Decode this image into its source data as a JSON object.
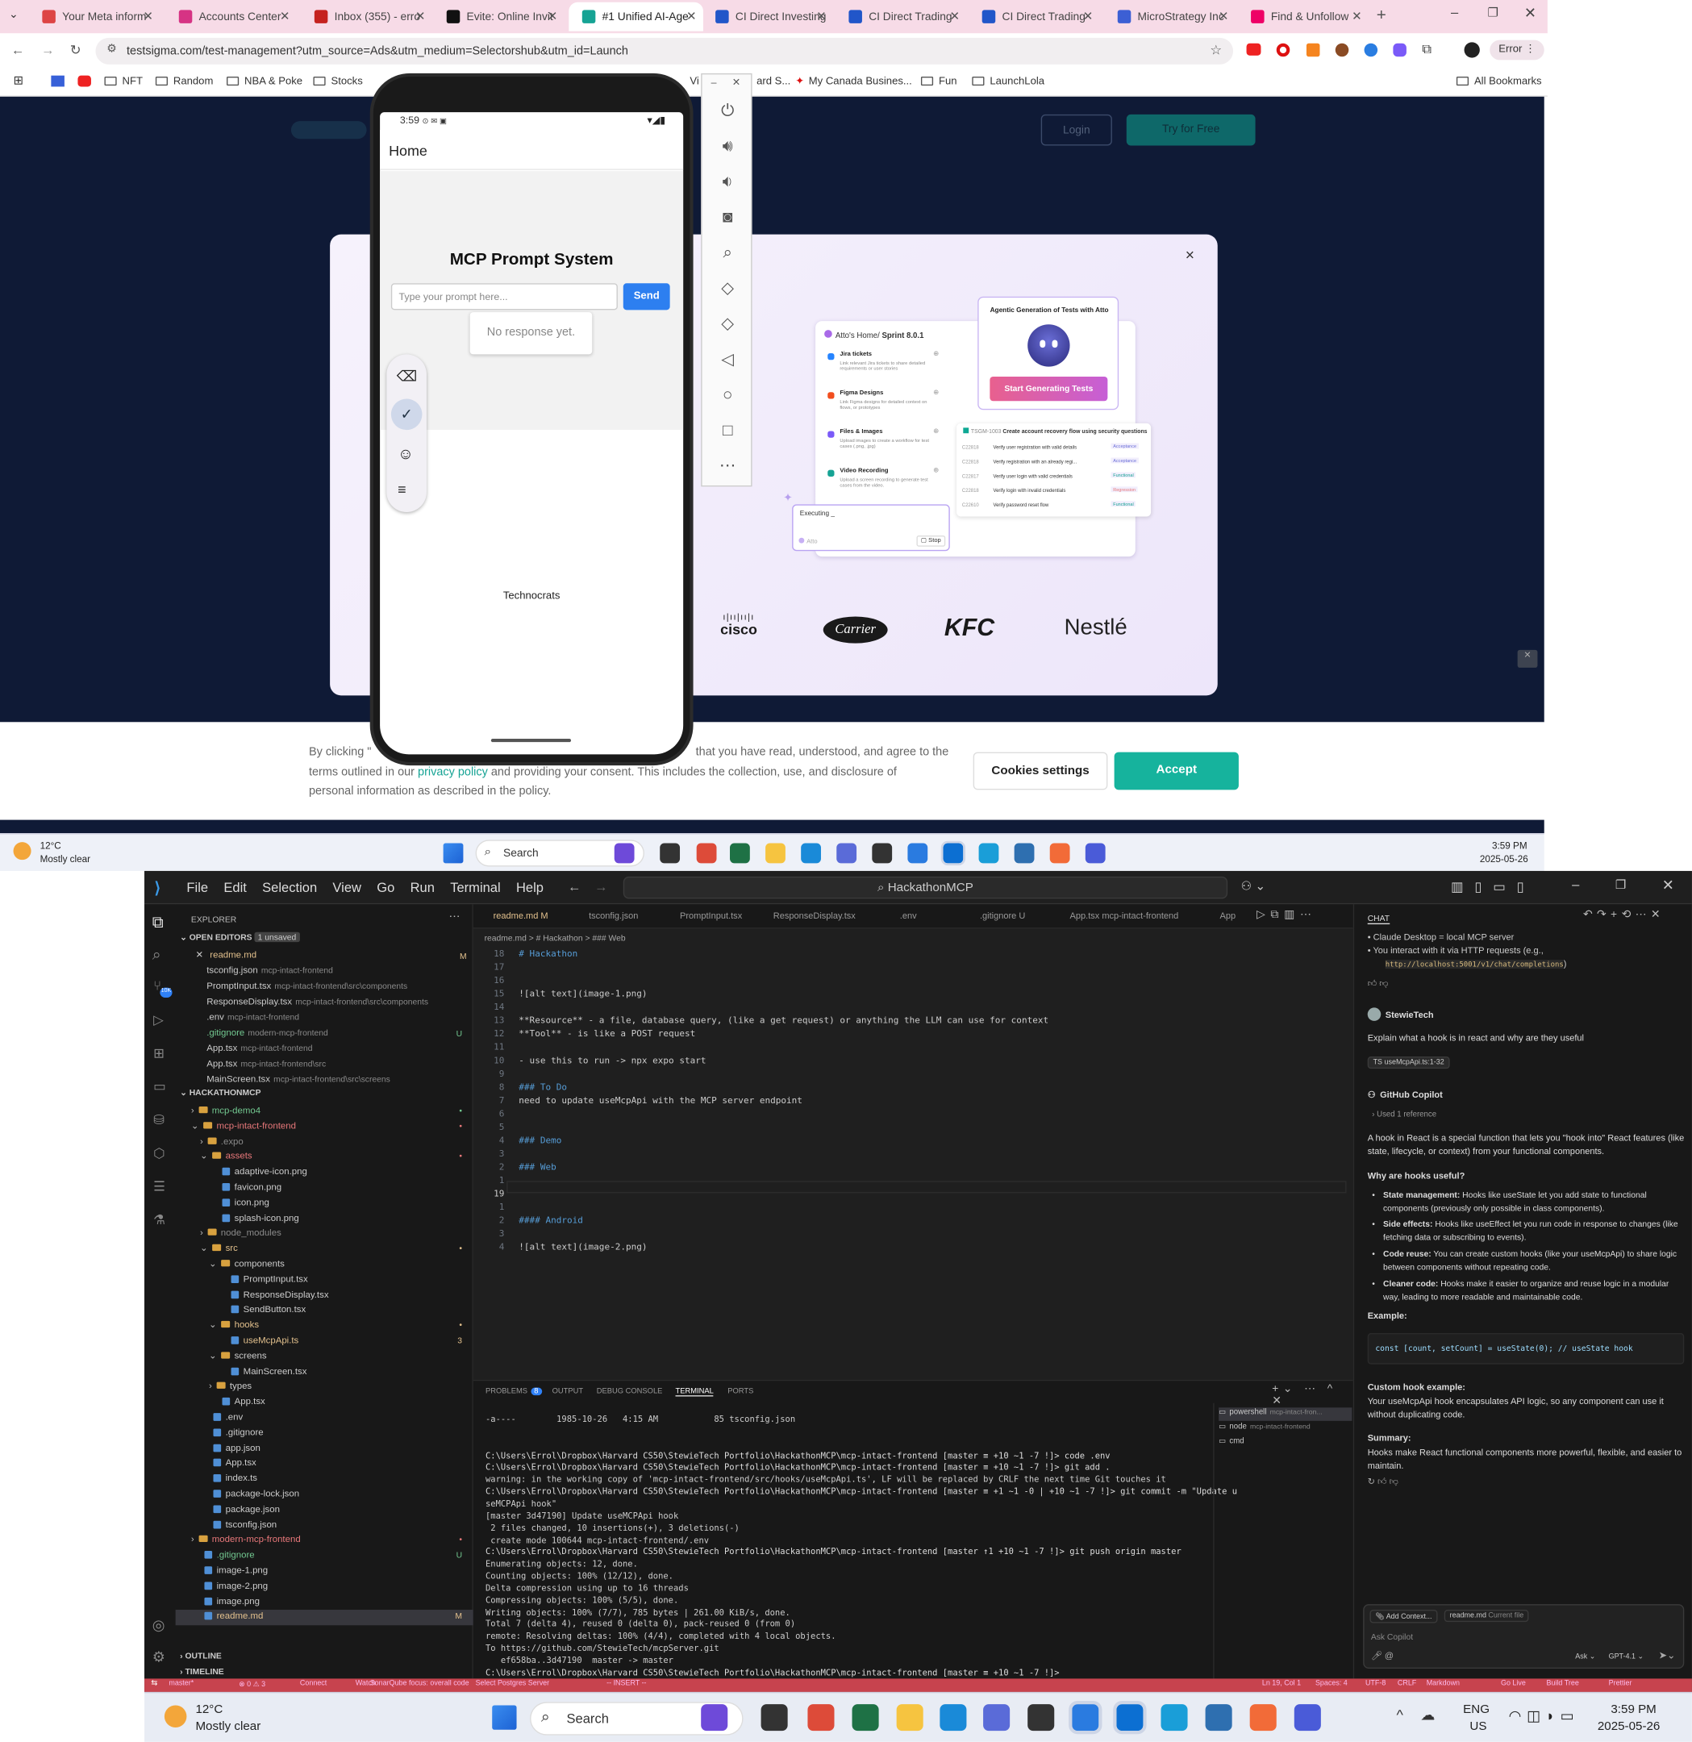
{
  "browser": {
    "tabs": [
      {
        "label": "Your Meta inform",
        "color": "#d44"
      },
      {
        "label": "Accounts Center",
        "color": "#d63384"
      },
      {
        "label": "Inbox (355) - erro",
        "color": "#c5221f"
      },
      {
        "label": "Evite: Online Invit",
        "color": "#111"
      },
      {
        "label": "#1 Unified AI-Age",
        "color": "#16a394"
      },
      {
        "label": "CI Direct Investing",
        "color": "#2156c9"
      },
      {
        "label": "CI Direct Trading",
        "color": "#2156c9"
      },
      {
        "label": "CI Direct Trading",
        "color": "#2156c9"
      },
      {
        "label": "MicroStrategy Inc",
        "color": "#3c5fd4"
      },
      {
        "label": "Find & Unfollow",
        "color": "#e06"
      }
    ],
    "url": "testsigma.com/test-management?utm_source=Ads&utm_medium=Selectorshub&utm_id=Launch",
    "error_label": "Error",
    "bookmarks": [
      "NFT",
      "Random",
      "NBA & Poke",
      "Stocks",
      "My Canada Busines...",
      "Fun",
      "LaunchLola",
      "All Bookmarks"
    ],
    "bookmark_fragment": "Vi",
    "bookmark_fragment2": "ard S..."
  },
  "webpage": {
    "modal": {
      "atto_home": "Atto's Home/",
      "sprint": "Sprint 8.0.1",
      "agentic_title": "Agentic Generation of Tests with Atto",
      "start_button": "Start Generating Tests",
      "items": [
        {
          "title": "Jira tickets",
          "desc": "Link relevant Jira tickets to share detailed requirements or user stories"
        },
        {
          "title": "Figma Designs",
          "desc": "Link Figma designs for detailed context on flows, or prototypes"
        },
        {
          "title": "Files & Images",
          "desc": "Upload images to create a workflow for test cases (.png, .jpg)"
        },
        {
          "title": "Video Recording",
          "desc": "Upload a screen recording to generate test cases from the video."
        }
      ],
      "test_header_id": "TSGM-1003",
      "test_header": "Create account recovery flow using security questions",
      "tests": [
        {
          "id": "C22818",
          "name": "Verify user registration with valid details",
          "tag": "Acceptance"
        },
        {
          "id": "C22818",
          "name": "Verify registration with an already regi...",
          "tag": "Acceptance"
        },
        {
          "id": "C22817",
          "name": "Verify user login with valid credentials",
          "tag": "Functional"
        },
        {
          "id": "C22818",
          "name": "Verify login with invalid credentials",
          "tag": "Regression"
        },
        {
          "id": "C22610",
          "name": "Verify password reset flow",
          "tag": "Functional"
        }
      ],
      "executing": "Executing _",
      "atto_label": "Atto",
      "stop_label": "Stop",
      "logos": [
        "cisco",
        "Carrier",
        "KFC",
        "Nestlé"
      ],
      "close": "×"
    },
    "nav": {
      "login": "Login",
      "try": "Try for Free"
    },
    "cookie": {
      "text1": "By clicking \"",
      "text1b": "that you have read, understood, and agree to the",
      "text2": "terms outlined in our",
      "link": "privacy policy",
      "text2b": "and providing your consent. This includes the collection, use, and disclosure of",
      "text3": "personal information as described in the policy.",
      "settings": "Cookies settings",
      "accept": "Accept"
    }
  },
  "phone": {
    "time": "3:59",
    "header": "Home",
    "title": "MCP Prompt System",
    "input_placeholder": "Type your prompt here...",
    "send": "Send",
    "response": "No response yet.",
    "footer": "Technocrats"
  },
  "emulator_icons": [
    "power-icon",
    "volume-up-icon",
    "volume-down-icon",
    "camera-icon",
    "zoom-icon",
    "rotate-left-icon",
    "rotate-right-icon",
    "back-icon",
    "home-icon",
    "overview-icon",
    "more-icon"
  ],
  "taskbar_top": {
    "weather_temp": "12°C",
    "weather_desc": "Mostly clear",
    "search": "Search",
    "time": "3:59 PM",
    "date": "2025-05-26"
  },
  "vscode": {
    "menu": [
      "File",
      "Edit",
      "Selection",
      "View",
      "Go",
      "Run",
      "Terminal",
      "Help"
    ],
    "command_center": "HackathonMCP",
    "explorer_title": "EXPLORER",
    "open_editors": "OPEN EDITORS",
    "unsaved": "1 unsaved",
    "open_files": [
      {
        "name": "readme.md",
        "path": "",
        "badge": "M",
        "color": "#e2c08d"
      },
      {
        "name": "tsconfig.json",
        "path": "mcp-intact-frontend",
        "badge": "",
        "color": "#ccc"
      },
      {
        "name": "PromptInput.tsx",
        "path": "mcp-intact-frontend\\src\\components",
        "badge": "",
        "color": "#ccc"
      },
      {
        "name": "ResponseDisplay.tsx",
        "path": "mcp-intact-frontend\\src\\components",
        "badge": "",
        "color": "#ccc"
      },
      {
        "name": ".env",
        "path": "mcp-intact-frontend",
        "badge": "",
        "color": "#ccc"
      },
      {
        "name": ".gitignore",
        "path": "modern-mcp-frontend",
        "badge": "U",
        "color": "#73c991"
      },
      {
        "name": "App.tsx",
        "path": "mcp-intact-frontend",
        "badge": "",
        "color": "#ccc"
      },
      {
        "name": "App.tsx",
        "path": "mcp-intact-frontend\\src",
        "badge": "",
        "color": "#ccc"
      },
      {
        "name": "MainScreen.tsx",
        "path": "mcp-intact-frontend\\src\\screens",
        "badge": "",
        "color": "#ccc"
      }
    ],
    "workspace": "HACKATHONMCP",
    "tree": [
      {
        "name": "mcp-demo4",
        "depth": 1,
        "color": "#73c991",
        "badge": "•",
        "folder": true
      },
      {
        "name": "mcp-intact-frontend",
        "depth": 1,
        "color": "#e8787a",
        "badge": "•",
        "folder": true,
        "open": true
      },
      {
        "name": ".expo",
        "depth": 2,
        "color": "#8b8b8b",
        "badge": "",
        "folder": true
      },
      {
        "name": "assets",
        "depth": 2,
        "color": "#e8787a",
        "badge": "•",
        "folder": true,
        "open": true
      },
      {
        "name": "adaptive-icon.png",
        "depth": 3,
        "color": "#ccc",
        "badge": ""
      },
      {
        "name": "favicon.png",
        "depth": 3,
        "color": "#ccc",
        "badge": ""
      },
      {
        "name": "icon.png",
        "depth": 3,
        "color": "#ccc",
        "badge": ""
      },
      {
        "name": "splash-icon.png",
        "depth": 3,
        "color": "#ccc",
        "badge": ""
      },
      {
        "name": "node_modules",
        "depth": 2,
        "color": "#8b8b8b",
        "badge": "",
        "folder": true
      },
      {
        "name": "src",
        "depth": 2,
        "color": "#e2c08d",
        "badge": "•",
        "folder": true,
        "open": true
      },
      {
        "name": "components",
        "depth": 3,
        "color": "#ccc",
        "badge": "",
        "folder": true,
        "open": true
      },
      {
        "name": "PromptInput.tsx",
        "depth": 4,
        "color": "#ccc",
        "badge": ""
      },
      {
        "name": "ResponseDisplay.tsx",
        "depth": 4,
        "color": "#ccc",
        "badge": ""
      },
      {
        "name": "SendButton.tsx",
        "depth": 4,
        "color": "#ccc",
        "badge": ""
      },
      {
        "name": "hooks",
        "depth": 3,
        "color": "#e2c08d",
        "badge": "•",
        "folder": true,
        "open": true
      },
      {
        "name": "useMcpApi.ts",
        "depth": 4,
        "color": "#e2c08d",
        "badge": "3"
      },
      {
        "name": "screens",
        "depth": 3,
        "color": "#ccc",
        "badge": "",
        "folder": true,
        "open": true
      },
      {
        "name": "MainScreen.tsx",
        "depth": 4,
        "color": "#ccc",
        "badge": ""
      },
      {
        "name": "types",
        "depth": 3,
        "color": "#ccc",
        "badge": "",
        "folder": true
      },
      {
        "name": "App.tsx",
        "depth": 3,
        "color": "#ccc",
        "badge": ""
      },
      {
        "name": ".env",
        "depth": 2,
        "color": "#ccc",
        "badge": ""
      },
      {
        "name": ".gitignore",
        "depth": 2,
        "color": "#ccc",
        "badge": ""
      },
      {
        "name": "app.json",
        "depth": 2,
        "color": "#ccc",
        "badge": ""
      },
      {
        "name": "App.tsx",
        "depth": 2,
        "color": "#ccc",
        "badge": ""
      },
      {
        "name": "index.ts",
        "depth": 2,
        "color": "#ccc",
        "badge": ""
      },
      {
        "name": "package-lock.json",
        "depth": 2,
        "color": "#ccc",
        "badge": ""
      },
      {
        "name": "package.json",
        "depth": 2,
        "color": "#ccc",
        "badge": ""
      },
      {
        "name": "tsconfig.json",
        "depth": 2,
        "color": "#ccc",
        "badge": ""
      },
      {
        "name": "modern-mcp-frontend",
        "depth": 1,
        "color": "#e8787a",
        "badge": "•",
        "folder": true
      },
      {
        "name": ".gitignore",
        "depth": 1,
        "color": "#73c991",
        "badge": "U"
      },
      {
        "name": "image-1.png",
        "depth": 1,
        "color": "#ccc",
        "badge": ""
      },
      {
        "name": "image-2.png",
        "depth": 1,
        "color": "#ccc",
        "badge": ""
      },
      {
        "name": "image.png",
        "depth": 1,
        "color": "#ccc",
        "badge": ""
      },
      {
        "name": "readme.md",
        "depth": 1,
        "color": "#e2c08d",
        "badge": "M"
      }
    ],
    "outline": "OUTLINE",
    "timeline": "TIMELINE",
    "editor_tabs": [
      "readme.md M",
      "tsconfig.json",
      "PromptInput.tsx",
      "ResponseDisplay.tsx",
      ".env",
      ".gitignore U",
      "App.tsx mcp-intact-frontend",
      "App"
    ],
    "breadcrumb": "readme.md > # Hackathon > ### Web",
    "code_lines": [
      {
        "n": "18",
        "t": "# Hackathon"
      },
      {
        "n": "17",
        "t": ""
      },
      {
        "n": "16",
        "t": ""
      },
      {
        "n": "15",
        "t": "![alt text](image-1.png)"
      },
      {
        "n": "14",
        "t": ""
      },
      {
        "n": "13",
        "t": "**Resource** - a file, database query, (like a get request) or anything the LLM can use for context"
      },
      {
        "n": "12",
        "t": "**Tool** - is like a POST request"
      },
      {
        "n": "11",
        "t": ""
      },
      {
        "n": "10",
        "t": "- use this to run -> npx expo start"
      },
      {
        "n": "9",
        "t": ""
      },
      {
        "n": "8",
        "t": "### To Do"
      },
      {
        "n": "7",
        "t": "need to update useMcpApi with the MCP server endpoint"
      },
      {
        "n": "6",
        "t": ""
      },
      {
        "n": "5",
        "t": ""
      },
      {
        "n": "4",
        "t": "### Demo"
      },
      {
        "n": "3",
        "t": ""
      },
      {
        "n": "2",
        "t": "### Web"
      },
      {
        "n": "1",
        "t": ""
      },
      {
        "n": "19",
        "t": ""
      },
      {
        "n": "1",
        "t": ""
      },
      {
        "n": "2",
        "t": "#### Android"
      },
      {
        "n": "3",
        "t": ""
      },
      {
        "n": "4",
        "t": "![alt text](image-2.png)"
      }
    ],
    "panel_tabs": [
      "PROBLEMS",
      "OUTPUT",
      "DEBUG CONSOLE",
      "TERMINAL",
      "PORTS"
    ],
    "problems_count": "8",
    "terminals": [
      {
        "name": "powershell",
        "path": "mcp-intact-fron..."
      },
      {
        "name": "node",
        "path": "mcp-intact-frontend"
      },
      {
        "name": "cmd",
        "path": ""
      }
    ],
    "terminal_lines": [
      "-a----        1985-10-26   4:15 AM           85 tsconfig.json",
      "",
      "",
      "C:\\Users\\Errol\\Dropbox\\Harvard CS50\\StewieTech Portfolio\\HackathonMCP\\mcp-intact-frontend [master ≡ +10 ~1 -7 !]> code .env",
      "C:\\Users\\Errol\\Dropbox\\Harvard CS50\\StewieTech Portfolio\\HackathonMCP\\mcp-intact-frontend [master ≡ +10 ~1 -7 !]> git add .",
      "warning: in the working copy of 'mcp-intact-frontend/src/hooks/useMcpApi.ts', LF will be replaced by CRLF the next time Git touches it",
      "C:\\Users\\Errol\\Dropbox\\Harvard CS50\\StewieTech Portfolio\\HackathonMCP\\mcp-intact-frontend [master ≡ +1 ~1 -0 | +10 ~1 -7 !]> git commit -m \"Update u",
      "seMCPApi hook\"",
      "[master 3d47190] Update useMCPApi hook",
      " 2 files changed, 10 insertions(+), 3 deletions(-)",
      " create mode 100644 mcp-intact-frontend/.env",
      "C:\\Users\\Errol\\Dropbox\\Harvard CS50\\StewieTech Portfolio\\HackathonMCP\\mcp-intact-frontend [master ↑1 +10 ~1 -7 !]> git push origin master",
      "Enumerating objects: 12, done.",
      "Counting objects: 100% (12/12), done.",
      "Delta compression using up to 16 threads",
      "Compressing objects: 100% (5/5), done.",
      "Writing objects: 100% (7/7), 785 bytes | 261.00 KiB/s, done.",
      "Total 7 (delta 4), reused 0 (delta 0), pack-reused 0 (from 0)",
      "remote: Resolving deltas: 100% (4/4), completed with 4 local objects.",
      "To https://github.com/StewieTech/mcpServer.git",
      "   ef658ba..3d47190  master -> master",
      "C:\\Users\\Errol\\Dropbox\\Harvard CS50\\StewieTech Portfolio\\HackathonMCP\\mcp-intact-frontend [master ≡ +10 ~1 -7 !]> "
    ],
    "chat": {
      "title": "CHAT",
      "prev_bullets": [
        "Claude Desktop = local MCP server",
        "You interact with it via HTTP requests (e.g.,"
      ],
      "prev_code": "http://localhost:5001/v1/chat/completions",
      "user_name": "StewieTech",
      "user_msg": "Explain what a hook is in react and why are they useful",
      "ref_chip": "useMcpApi.ts:1-32",
      "bot_name": "GitHub Copilot",
      "used_ref": "Used 1 reference",
      "intro_bold": "hook",
      "intro": "A hook in React is a special function that lets you \"hook into\" React features (like state, lifecycle, or context) from your functional components.",
      "why_heading": "Why are hooks useful?",
      "bullets": [
        {
          "b": "State management:",
          "t": "Hooks like useState let you add state to functional components (previously only possible in class components)."
        },
        {
          "b": "Side effects:",
          "t": "Hooks like useEffect let you run code in response to changes (like fetching data or subscribing to events)."
        },
        {
          "b": "Code reuse:",
          "t": "You can create custom hooks (like your useMcpApi) to share logic between components without repeating code."
        },
        {
          "b": "Cleaner code:",
          "t": "Hooks make it easier to organize and reuse logic in a modular way, leading to more readable and maintainable code."
        }
      ],
      "example_heading": "Example:",
      "example_code": "const [count, setCount] = useState(0); // useState hook",
      "custom_heading": "Custom hook example:",
      "custom_text": "Your useMcpApi hook encapsulates API logic, so any component can use it without duplicating code.",
      "summary_heading": "Summary:",
      "summary_text": "Hooks make React functional components more powerful, flexible, and easier to maintain.",
      "add_context": "Add Context...",
      "current_file": "readme.md",
      "current_file_label": "Current file",
      "placeholder": "Ask Copilot",
      "mode": "Ask",
      "model": "GPT-4.1"
    },
    "status": {
      "branch": "master*",
      "errors": "⊗ 0 ⚠ 3",
      "connect": "Connect",
      "watch": "Watch",
      "sonar": "SonarQube focus: overall code",
      "postgres": "Select Postgres Server",
      "insert": "-- INSERT --",
      "ln_col": "Ln 19, Col 1",
      "spaces": "Spaces: 4",
      "encoding": "UTF-8",
      "eol": "CRLF",
      "lang": "Markdown",
      "golive": "Go Live",
      "build": "Build Tree",
      "prettier": "Prettier"
    }
  },
  "taskbar_bottom": {
    "weather_temp": "12°C",
    "weather_desc": "Mostly clear",
    "search": "Search",
    "lang1": "ENG",
    "lang2": "US",
    "time": "3:59 PM",
    "date": "2025-05-26"
  }
}
